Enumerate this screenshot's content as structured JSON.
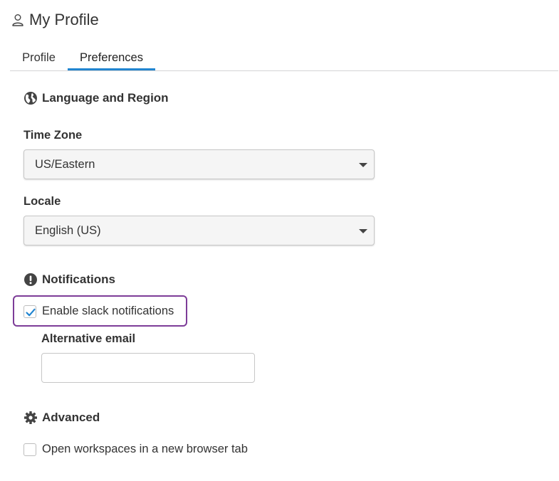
{
  "header": {
    "title": "My Profile",
    "icon": "user-icon"
  },
  "tabs": [
    {
      "label": "Profile",
      "active": false
    },
    {
      "label": "Preferences",
      "active": true
    }
  ],
  "sections": {
    "language_region": {
      "heading": "Language and Region",
      "icon": "globe-icon",
      "time_zone": {
        "label": "Time Zone",
        "value": "US/Eastern"
      },
      "locale": {
        "label": "Locale",
        "value": "English (US)"
      }
    },
    "notifications": {
      "heading": "Notifications",
      "icon": "exclamation-circle-icon",
      "slack": {
        "label": "Enable slack notifications",
        "checked": true
      },
      "alt_email": {
        "label": "Alternative email",
        "value": "",
        "placeholder": ""
      }
    },
    "advanced": {
      "heading": "Advanced",
      "icon": "gear-icon",
      "new_tab": {
        "label": "Open workspaces in a new browser tab",
        "checked": false
      }
    }
  },
  "colors": {
    "accent": "#2185d0",
    "highlight": "#7d3c98",
    "check": "#2185d0"
  }
}
